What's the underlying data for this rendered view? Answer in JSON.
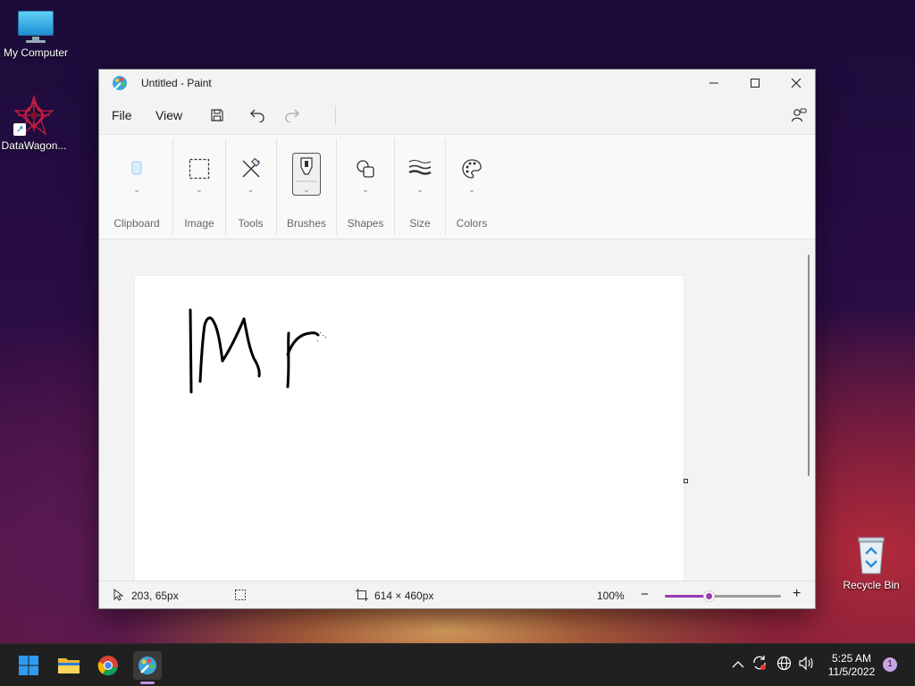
{
  "desktop": {
    "icons": [
      {
        "label": "My Computer"
      },
      {
        "label": "DataWagon..."
      },
      {
        "label": "Recycle Bin"
      }
    ]
  },
  "window": {
    "title": "Untitled - Paint",
    "menu": {
      "file": "File",
      "view": "View"
    },
    "ribbon": {
      "groups": [
        {
          "label": "Clipboard",
          "icon": "clipboard-icon"
        },
        {
          "label": "Image",
          "icon": "selection-icon"
        },
        {
          "label": "Tools",
          "icon": "tools-icon"
        },
        {
          "label": "Brushes",
          "icon": "brush-icon"
        },
        {
          "label": "Shapes",
          "icon": "shapes-icon"
        },
        {
          "label": "Size",
          "icon": "size-icon"
        },
        {
          "label": "Colors",
          "icon": "palette-icon"
        }
      ]
    },
    "status": {
      "cursor_position": "203, 65px",
      "canvas_size": "614 × 460px",
      "zoom": "100%",
      "zoom_level": 0.38
    }
  },
  "taskbar": {
    "apps": [
      "start-icon",
      "file-explorer-icon",
      "chrome-icon",
      "paint-icon"
    ],
    "clock": {
      "time": "5:25 AM",
      "date": "11/5/2022"
    },
    "notification_count": "1"
  },
  "colors": {
    "accent": "#9b3bb0",
    "taskbar": "#202020"
  }
}
